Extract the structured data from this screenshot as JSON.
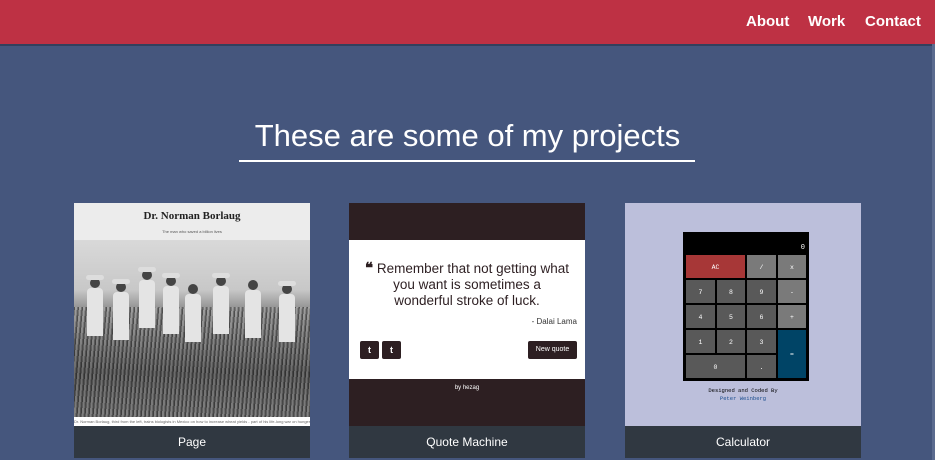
{
  "nav": {
    "items": [
      "About",
      "Work",
      "Contact"
    ]
  },
  "section": {
    "title": "These are some of my projects"
  },
  "projects": [
    {
      "caption": "Page",
      "preview": {
        "heading": "Dr. Norman Borlaug",
        "subheading": "The man who saved a billion lives",
        "photo_caption": "Dr. Norman Borlaug, third from the left, trains biologists in Mexico on how to increase wheat yields - part of his life-long war on hunger."
      }
    },
    {
      "caption": "Quote Machine",
      "preview": {
        "quote_mark": "❝",
        "quote": "Remember that not getting what you want is sometimes a wonderful stroke of luck.",
        "author": "- Dalai Lama",
        "twitter_glyph": "t",
        "tumblr_glyph": "t",
        "new_quote_label": "New quote",
        "footer": "by hezag"
      }
    },
    {
      "caption": "Calculator",
      "preview": {
        "display": "0",
        "keys": [
          "AC",
          "/",
          "x",
          "7",
          "8",
          "9",
          "-",
          "4",
          "5",
          "6",
          "+",
          "1",
          "2",
          "3",
          "=",
          "0",
          "."
        ],
        "credit_line1": "Designed and Coded By",
        "credit_line2": "Peter Weinberg"
      }
    }
  ],
  "colors": {
    "nav": "#be3144",
    "background": "#45567d",
    "caption_bar": "#303841"
  }
}
